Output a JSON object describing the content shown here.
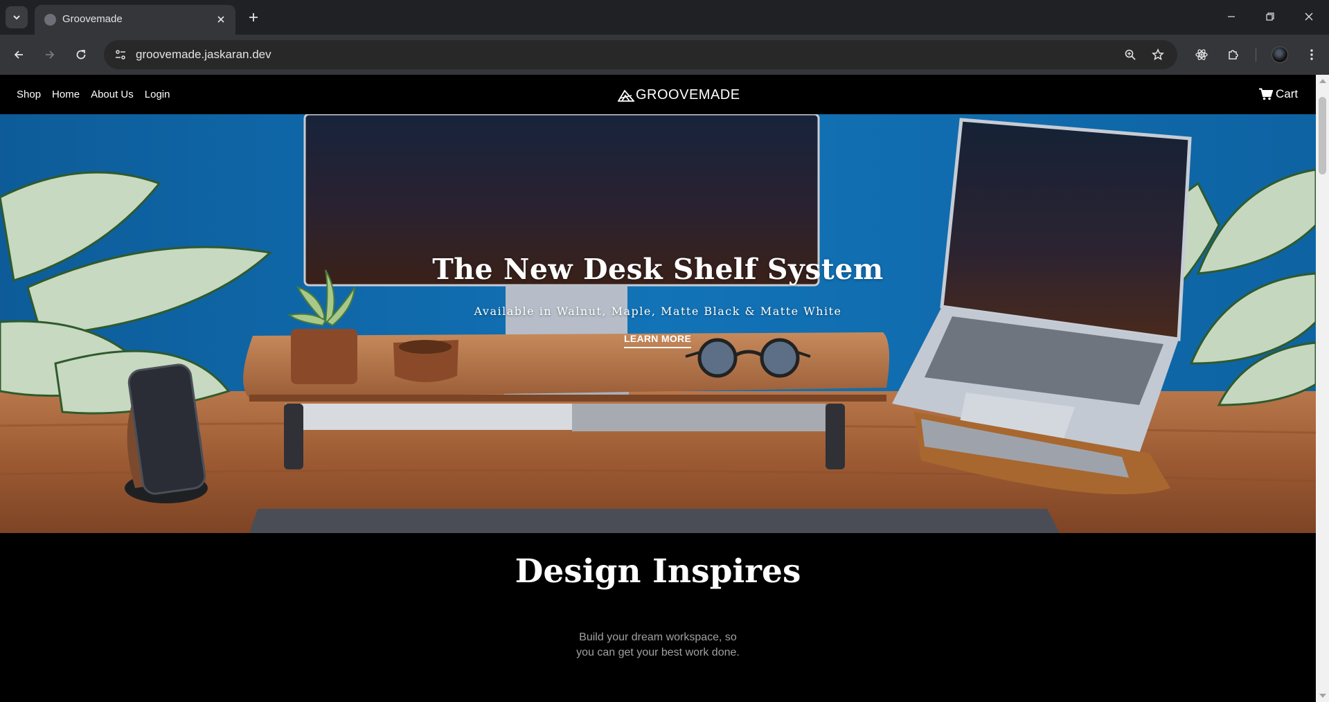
{
  "browser": {
    "tab_title": "Groovemade",
    "url": "groovemade.jaskaran.dev"
  },
  "site": {
    "nav": [
      "Shop",
      "Home",
      "About Us",
      "Login"
    ],
    "logo_text": "GROOVEMADE",
    "cart_label": "Cart"
  },
  "hero": {
    "title": "The New Desk Shelf System",
    "subtitle": "Available in Walnut, Maple, Matte Black & Matte White",
    "cta": "LEARN MORE"
  },
  "design": {
    "title": "Design Inspires",
    "body_line1": "Build your dream workspace, so",
    "body_line2": "you can get your best work done."
  },
  "colors": {
    "chrome_dark": "#202124",
    "chrome_toolbar": "#35363a",
    "hero_wall": "#1169a8",
    "page_bg": "#000000"
  }
}
